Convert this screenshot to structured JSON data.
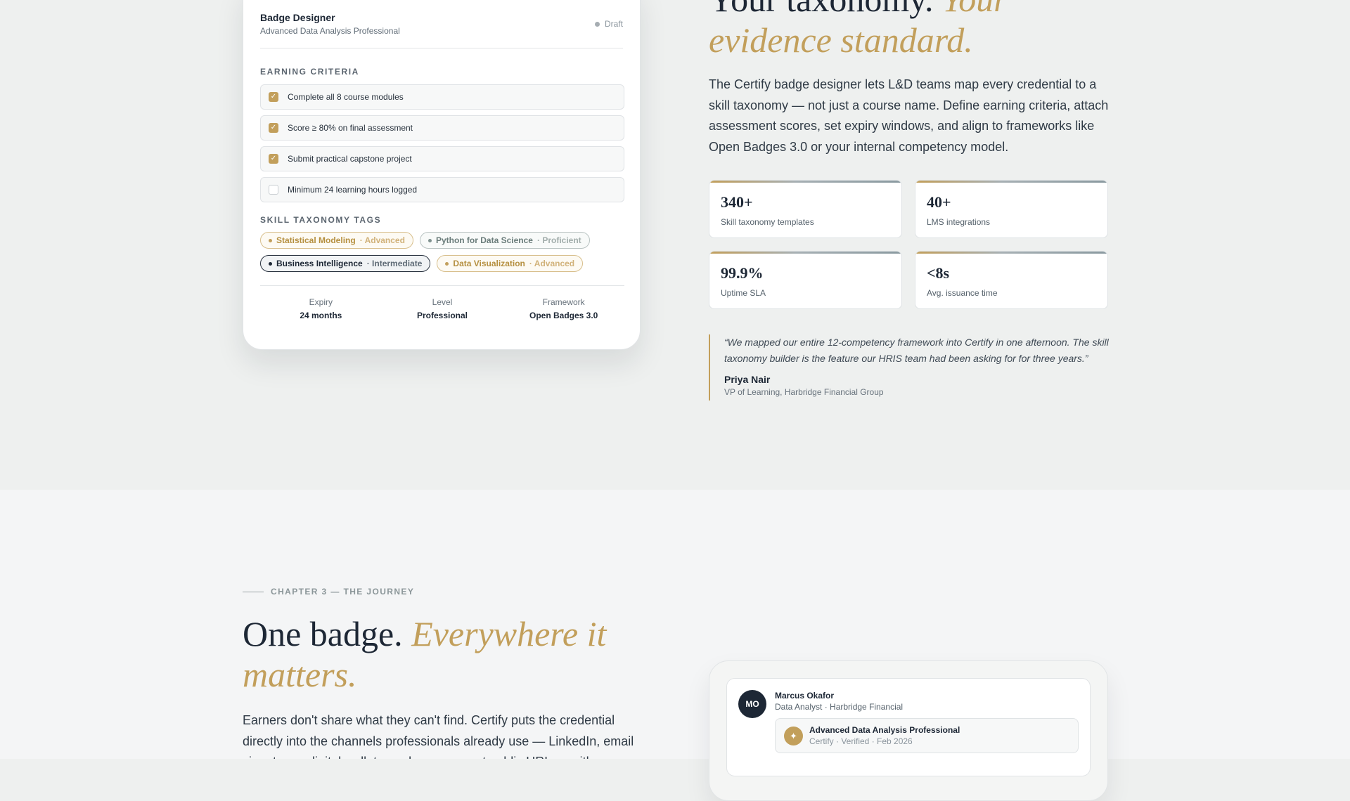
{
  "designer": {
    "title": "Badge Designer",
    "subtitle": "Advanced Data Analysis Professional",
    "status": "Draft",
    "criteria_label": "EARNING CRITERIA",
    "criteria": [
      {
        "label": "Complete all 8 course modules",
        "checked": true
      },
      {
        "label": "Score ≥ 80% on final assessment",
        "checked": true
      },
      {
        "label": "Submit practical capstone project",
        "checked": true
      },
      {
        "label": "Minimum 24 learning hours logged",
        "checked": false
      }
    ],
    "tags_label": "SKILL TAXONOMY TAGS",
    "tags": [
      {
        "name": "Statistical Modeling",
        "level": "· Advanced",
        "style": "gold"
      },
      {
        "name": "Python for Data Science",
        "level": "· Proficient",
        "style": "sage"
      },
      {
        "name": "Business Intelligence",
        "level": "· Intermediate",
        "style": "navy"
      },
      {
        "name": "Data Visualization",
        "level": "· Advanced",
        "style": "gold"
      }
    ],
    "footer": [
      {
        "key": "Expiry",
        "value": "24 months"
      },
      {
        "key": "Level",
        "value": "Professional"
      },
      {
        "key": "Framework",
        "value": "Open Badges 3.0"
      }
    ]
  },
  "section2": {
    "headline_plain": "Your taxonomy.",
    "headline_italic": "Your evidence standard.",
    "intro": "The Certify badge designer lets L&D teams map every credential to a skill taxonomy — not just a course name. Define earning criteria, attach assessment scores, set expiry windows, and align to frameworks like Open Badges 3.0 or your internal competency model.",
    "stats": [
      {
        "value": "340+",
        "label": "Skill taxonomy templates"
      },
      {
        "value": "40+",
        "label": "LMS integrations"
      },
      {
        "value": "99.9%",
        "label": "Uptime SLA"
      },
      {
        "value": "<8s",
        "label": "Avg. issuance time"
      }
    ],
    "quote": {
      "text": "“We mapped our entire 12-competency framework into Certify in one afternoon. The skill taxonomy builder is the feature our HRIS team had been asking for for three years.”",
      "name": "Priya Nair",
      "role": "VP of Learning, Harbridge Financial Group"
    }
  },
  "section3": {
    "chapter": "CHAPTER 3 — THE JOURNEY",
    "headline_plain": "One badge.",
    "headline_italic": "Everywhere it matters.",
    "intro": "Earners don't share what they can't find. Certify puts the credential directly into the channels professionals already use — LinkedIn, email signatures, digital wallets, and a permanent public URL — with a single",
    "profile": {
      "initials": "MO",
      "name": "Marcus Okafor",
      "role": "Data Analyst · Harbridge Financial",
      "badge_title": "Advanced Data Analysis Professional",
      "badge_sub": "Certify · Verified · Feb 2026",
      "badge_icon": "star-icon"
    }
  },
  "colors": {
    "accent_gold": "#c29f5b",
    "navy": "#1d2735",
    "sage": "#7f918f"
  }
}
